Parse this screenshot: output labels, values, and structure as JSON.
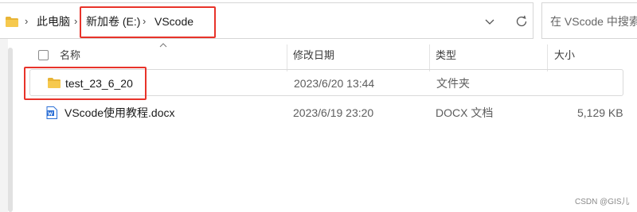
{
  "breadcrumb": {
    "items": [
      "此电脑",
      "新加卷 (E:)",
      "VScode"
    ],
    "separator": "›"
  },
  "search": {
    "placeholder": "在 VScode 中搜索"
  },
  "columns": {
    "name": "名称",
    "modified": "修改日期",
    "type": "类型",
    "size": "大小"
  },
  "files": [
    {
      "name": "test_23_6_20",
      "modified": "2023/6/20 13:44",
      "type": "文件夹",
      "size": "",
      "icon": "folder-icon"
    },
    {
      "name": "VScode使用教程.docx",
      "modified": "2023/6/19 23:20",
      "type": "DOCX 文档",
      "size": "5,129 KB",
      "icon": "word-doc-icon"
    }
  ],
  "watermark": "CSDN @GIS儿",
  "colors": {
    "highlight": "#e8332a",
    "folder": "#f4c244",
    "word": "#2b6fd6"
  }
}
